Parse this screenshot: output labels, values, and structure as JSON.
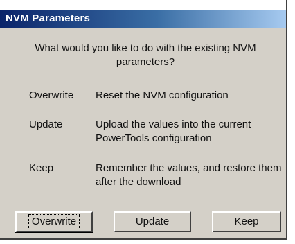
{
  "window": {
    "title": "NVM Parameters"
  },
  "question": "What would you like to do with the existing NVM parameters?",
  "options": [
    {
      "name": "Overwrite",
      "description": "Reset the NVM configuration"
    },
    {
      "name": "Update",
      "description": "Upload the values into the current PowerTools configuration"
    },
    {
      "name": "Keep",
      "description": "Remember the values, and restore them after the download"
    }
  ],
  "buttons": {
    "overwrite": "Overwrite",
    "update": "Update",
    "keep": "Keep"
  }
}
